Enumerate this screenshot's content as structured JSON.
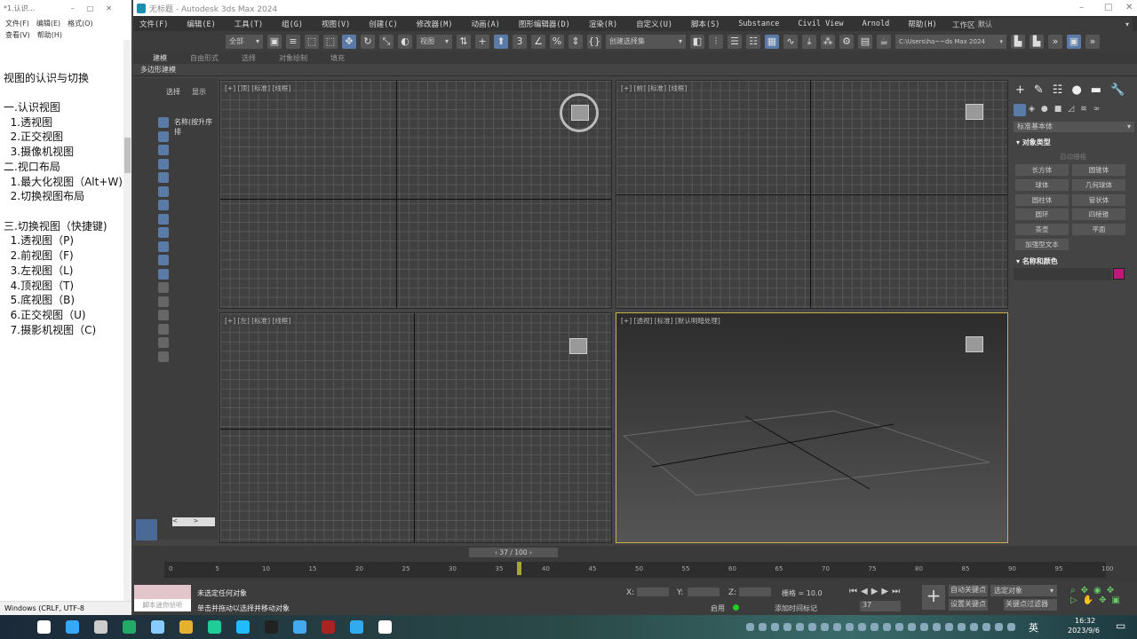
{
  "notepad": {
    "title": "*1.认识...",
    "menu": [
      "文件(F)",
      "编辑(E)",
      "格式(O)",
      "查看(V)",
      "帮助(H)"
    ],
    "lines": [
      "",
      "视图的认识与切换",
      "",
      "一.认识视图",
      "  1.透视图",
      "  2.正交视图",
      "  3.摄像机视图",
      "二.视口布局",
      "  1.最大化视图（Alt+W)",
      "  2.切换视图布局",
      "",
      "三.切换视图（快捷键)",
      "  1.透视图（P)",
      "  2.前视图（F)",
      "  3.左视图（L)",
      "  4.顶视图（T)",
      "  5.底视图（B)",
      "  6.正交视图（U)",
      "  7.摄影机视图（C)"
    ],
    "status": "Windows (CRLF, UTF-8"
  },
  "max": {
    "title": "无标题 - Autodesk 3ds Max 2024",
    "menu": [
      "文件(F)",
      "编辑(E)",
      "工具(T)",
      "组(G)",
      "视图(V)",
      "创建(C)",
      "修改器(M)",
      "动画(A)",
      "图形编辑器(D)",
      "渲染(R)",
      "自定义(U)",
      "脚本(S)",
      "Substance",
      "Civil View",
      "Arnold",
      "帮助(H)"
    ],
    "workspace_label": "工作区:",
    "workspace_value": "默认",
    "selection_filter": "全部",
    "ref_coord": "视图",
    "named_selection": "创建选择集",
    "project_path": "C:\\Users\\ha~~ds Max 2024",
    "ribbon_tabs": [
      "建模",
      "自由形式",
      "选择",
      "对象绘制",
      "填充"
    ],
    "ribbon_sub": "多边形建模",
    "scene_tabs": [
      "选择",
      "显示"
    ],
    "scene_column": "名称(按升序排",
    "viewports": [
      {
        "label": "[+] [顶] [标准] [线框]"
      },
      {
        "label": "[+] [前] [标准] [线框]"
      },
      {
        "label": "[+] [左] [标准] [线框]"
      },
      {
        "label": "[+] [透视] [标准] [默认明暗处理]"
      }
    ],
    "command": {
      "category": "标准基本体",
      "rollout_object_type": "对象类型",
      "auto_grid": "自动栅格",
      "buttons": [
        "长方体",
        "圆锥体",
        "球体",
        "几何球体",
        "圆柱体",
        "管状体",
        "圆环",
        "四棱锥",
        "茶壶",
        "平面",
        "加强型文本"
      ],
      "rollout_name_color": "名称和颜色",
      "object_color": "#c0187a"
    },
    "time": {
      "frame": "37 / 100",
      "current": 37,
      "max": 100,
      "ticks": [
        "0",
        "5",
        "10",
        "15",
        "20",
        "25",
        "30",
        "35",
        "40",
        "45",
        "50",
        "55",
        "60",
        "65",
        "70",
        "75",
        "80",
        "85",
        "90",
        "95",
        "100"
      ]
    },
    "status": {
      "listener": "脚本迷你侦听",
      "line1": "未选定任何对象",
      "line2": "单击并拖动以选择并移动对象",
      "x": "X:",
      "y": "Y:",
      "z": "Z:",
      "grid": "栅格 = 10.0",
      "enable": "启用",
      "add_time_tag": "添加时间标记",
      "frame_field": "37",
      "auto_key": "自动关键点",
      "selected": "选定对象",
      "set_key": "设置关键点",
      "key_filter": "关键点过滤器"
    }
  },
  "taskbar": {
    "lang": "英",
    "time": "16:32",
    "date": "2023/9/6"
  }
}
